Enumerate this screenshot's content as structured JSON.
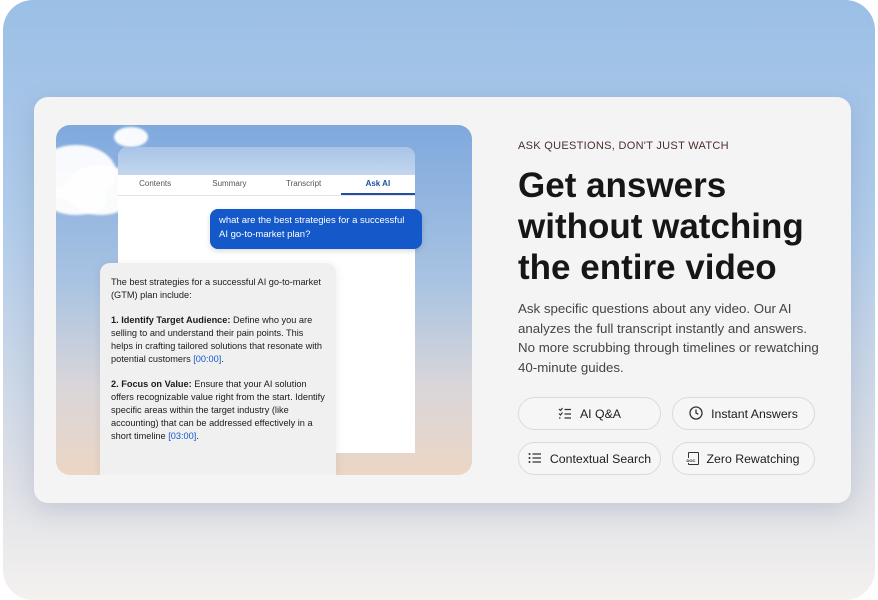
{
  "preview": {
    "tabs": [
      "Contents",
      "Summary",
      "Transcript",
      "Ask AI"
    ],
    "active_tab": "Ask AI",
    "user_question": "what are the best strategies for a successful AI go-to-market plan?",
    "ai_intro": "The best strategies for a successful AI go-to-market (GTM) plan include:",
    "points": [
      {
        "title": "1. Identify Target Audience:",
        "body": "Define who you are selling to and understand their pain points. This helps in crafting tailored solutions that resonate with potential customers",
        "timestamp": "[00:00]"
      },
      {
        "title": "2. Focus on Value:",
        "body": "Ensure that your AI solution offers recognizable value right from the start. Identify specific areas within the target industry (like accounting) that can be addressed effectively in a short timeline",
        "timestamp": "[03:00]"
      }
    ]
  },
  "eyebrow": "ASK QUESTIONS, DON'T JUST WATCH",
  "headline": "Get answers without watching the entire video",
  "description": "Ask specific questions about any video. Our AI analyzes the full transcript instantly and answers. No more scrubbing through timelines or rewatching 40-minute guides.",
  "features": [
    {
      "label": "AI Q&A",
      "icon": "checklist-icon"
    },
    {
      "label": "Instant Answers",
      "icon": "clock-icon"
    },
    {
      "label": "Contextual Search",
      "icon": "list-icon"
    },
    {
      "label": "Zero Rewatching",
      "icon": "doc-icon"
    }
  ],
  "doc_icon_text": "DOC",
  "colors": {
    "accent": "#1458c9",
    "headline": "#161616",
    "eyebrow": "#4a2e2e"
  }
}
